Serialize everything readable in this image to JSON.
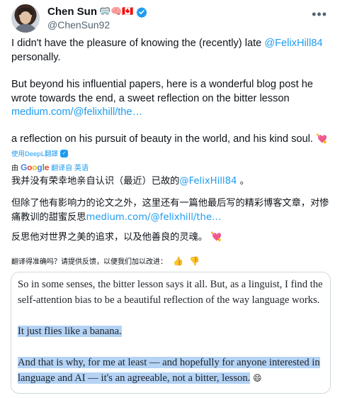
{
  "author": {
    "name": "Chen Sun",
    "name_emojis": "🥽🧠🇨🇦",
    "handle": "@ChenSun92"
  },
  "tweet": {
    "p1_text": "I didn't have the pleasure of knowing the (recently) late ",
    "p1_mention": "@FelixHill84",
    "p1_tail": "personally.",
    "p2_text": "But beyond his influential papers, here is a wonderful blog post he wrote towards the end, a sweet reflection on the bitter lesson",
    "p2_link": "medium.com/@felixhill/the…",
    "p3_text": "a reflection on his pursuit of beauty in the world, and his kind soul.",
    "heart_emoji": "💘"
  },
  "translation": {
    "deepl_label": "使用DeepL翻譯",
    "by_label": "由",
    "google_logo": [
      "G",
      "o",
      "o",
      "g",
      "l",
      "e"
    ],
    "translate_label": "翻译自 英语",
    "zh_p1_text": "我并没有荣幸地亲自认识（最近）已故的",
    "zh_p1_mention": "@FelixHill84",
    "zh_p1_tail": " 。",
    "zh_p2_text": "但除了他有影响力的论文之外，这里还有一篇他最后写的精彩博客文章，对惨痛教训的甜蜜反思",
    "zh_p2_link": "medium.com/@felixhill/the…",
    "zh_p3_text": "反思他对世界之美的追求，以及他善良的灵魂。",
    "feedback_prompt": "翻译得准确吗？请提供反馈，以便我们加以改进：",
    "thumb_up": "👍",
    "thumb_down": "👎"
  },
  "quote_image": {
    "line1": "So in some senses, the bitter lesson says it all. But, as a linguist, I find the",
    "line2": "self-attention bias to be a beautiful reflection of the way language works.",
    "line3": "It just flies like a banana.",
    "line4": "And that is why, for me at least — and hopefully for anyone interested in",
    "line5": "language and AI — it's an agreeable, not a bitter, lesson.",
    "line5_emoji": "😄"
  },
  "colors": {
    "link": "#1d9bf0",
    "highlight": "#b4d3f5",
    "text": "#0f1419",
    "muted": "#536471"
  },
  "icons": {
    "more": "more-horizontal-icon",
    "verified": "verified-badge-icon",
    "deepl": "deepl-icon"
  }
}
